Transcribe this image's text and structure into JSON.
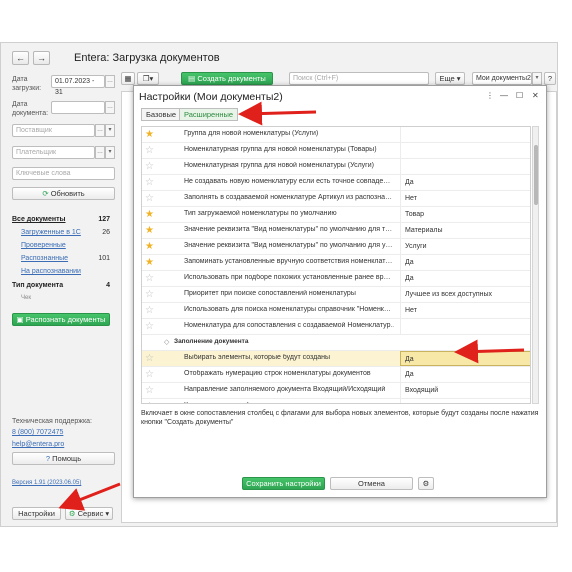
{
  "app": {
    "title": "Entera: Загрузка документов",
    "back_icon": "arrow-left-icon",
    "forward_icon": "arrow-right-icon"
  },
  "filters": {
    "upload_date_label": "Дата загрузки:",
    "upload_date_value": "01.07.2023 - 31",
    "doc_date_label": "Дата документа:",
    "supplier_placeholder": "Поставщик",
    "payer_placeholder": "Плательщик",
    "keywords_placeholder": "Ключевые слова",
    "refresh_label": "Обновить"
  },
  "nav": {
    "all_docs": {
      "label": "Все документы",
      "count": "127"
    },
    "loaded_1c": {
      "label": "Загруженные в 1С",
      "count": "26"
    },
    "checked": {
      "label": "Проверенные"
    },
    "recognized": {
      "label": "Распознанные",
      "count": "101"
    },
    "recognizing": {
      "label": "На распознавании"
    },
    "doc_type": {
      "label": "Тип документа",
      "count": "4"
    },
    "doc_type_sub": "Чек",
    "recognize_button": "Распознать документы"
  },
  "support": {
    "label": "Техническая поддержка:",
    "phone": "8 (800) 7072475",
    "email": "help@entera.pro",
    "help_button": "Помощь",
    "version": "Версия 1.91 (2023.06.05)"
  },
  "bottom": {
    "settings_button": "Настройки",
    "service_button": "Сервис"
  },
  "toolbar": {
    "create_docs": "Создать документы",
    "search_placeholder": "Поиск (Ctrl+F)",
    "more": "Еще",
    "my_docs_select": "Мои документы2",
    "help": "?"
  },
  "dialog": {
    "title": "Настройки (Мои документы2)",
    "tab_basic": "Базовые",
    "tab_advanced": "Расширенные",
    "rows": [
      {
        "star": true,
        "name": "Группа для новой номенклатуры (Услуги)",
        "value": ""
      },
      {
        "star": false,
        "name": "Номенклатурная группа для новой номенклатуры (Товары)",
        "value": ""
      },
      {
        "star": false,
        "name": "Номенклатурная группа для новой номенклатуры (Услуги)",
        "value": ""
      },
      {
        "star": false,
        "name": "Не создавать новую номенклатуру если есть точное совпаде…",
        "value": "Да"
      },
      {
        "star": false,
        "name": "Заполнять в создаваемой номенклатуре Артикул из распозна…",
        "value": "Нет"
      },
      {
        "star": true,
        "name": "Тип загружаемой номенклатуры по умолчанию",
        "value": "Товар"
      },
      {
        "star": true,
        "name": "Значение реквизита \"Вид номенклатуры\" по умолчанию для т…",
        "value": "Материалы"
      },
      {
        "star": true,
        "name": "Значение реквизита \"Вид номенклатуры\" по умолчанию для у…",
        "value": "Услуги"
      },
      {
        "star": true,
        "name": "Запоминать установленные вручную соответствия номенклат…",
        "value": "Да"
      },
      {
        "star": false,
        "name": "Использовать при подборе похожих установленные ранее вр…",
        "value": "Да"
      },
      {
        "star": false,
        "name": "Приоритет при поиске сопоставлений номенклатуры",
        "value": "Лучшее из всех доступных"
      },
      {
        "star": false,
        "name": "Использовать для поиска номенклатуры справочник \"Номенк…",
        "value": "Нет"
      },
      {
        "star": false,
        "name": "Номенклатура для сопоставления с создаваемой Номенклатур…",
        "value": ""
      }
    ],
    "group_label": "Заполнение документа",
    "group_rows": [
      {
        "star": false,
        "name": "Выбирать элементы, которые будут созданы",
        "value": "Да",
        "selected": true
      },
      {
        "star": false,
        "name": "Отображать нумерацию строк номенклатуры документов",
        "value": "Да"
      },
      {
        "star": false,
        "name": "Направление заполняемого документа Входящий/Исходящий",
        "value": "Входящий"
      },
      {
        "star": false,
        "name": "Контролировать дубликаты документов",
        "value": "Да"
      }
    ],
    "description": "Включает в окне сопоставления столбец с флагами для выбора  новых элементов, которые будут созданы после нажатия кнопки \"Создать документы\"",
    "save_button": "Сохранить настройки",
    "cancel_button": "Отмена"
  },
  "colors": {
    "accent_green": "#2ea552",
    "star": "#f0b323",
    "arrow_red": "#e0201a",
    "link": "#3a6db5"
  }
}
